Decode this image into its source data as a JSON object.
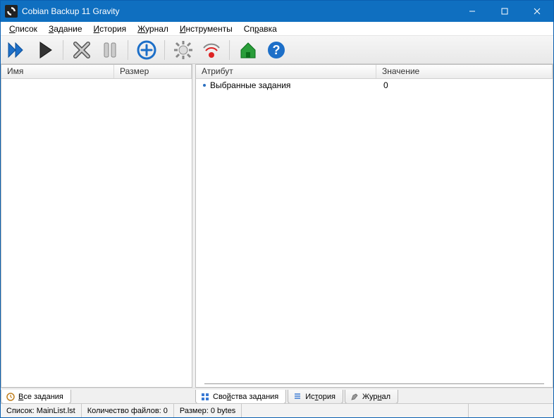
{
  "window": {
    "title": "Cobian Backup 11 Gravity"
  },
  "menu": {
    "items": [
      {
        "pre": "",
        "u": "С",
        "post": "писок"
      },
      {
        "pre": "",
        "u": "З",
        "post": "адание"
      },
      {
        "pre": "",
        "u": "И",
        "post": "стория"
      },
      {
        "pre": "",
        "u": "Ж",
        "post": "урнал"
      },
      {
        "pre": "",
        "u": "И",
        "post": "нструменты"
      },
      {
        "pre": "Сп",
        "u": "р",
        "post": "авка"
      }
    ]
  },
  "left_panel": {
    "columns": {
      "name": "Имя",
      "size": "Размер"
    }
  },
  "right_panel": {
    "columns": {
      "attribute": "Атрибут",
      "value": "Значение"
    },
    "rows": [
      {
        "attribute": "Выбранные задания",
        "value": "0"
      }
    ]
  },
  "tabs_left": [
    {
      "pre": "",
      "u": "В",
      "post": "се задания"
    }
  ],
  "tabs_right": [
    {
      "pre": "Сво",
      "u": "й",
      "post": "ства задания"
    },
    {
      "pre": "Ис",
      "u": "т",
      "post": "ория"
    },
    {
      "pre": "Жур",
      "u": "н",
      "post": "ал"
    }
  ],
  "status": {
    "list": "Список: MainList.lst",
    "count": "Количество файлов: 0",
    "size": "Размер: 0 bytes"
  }
}
